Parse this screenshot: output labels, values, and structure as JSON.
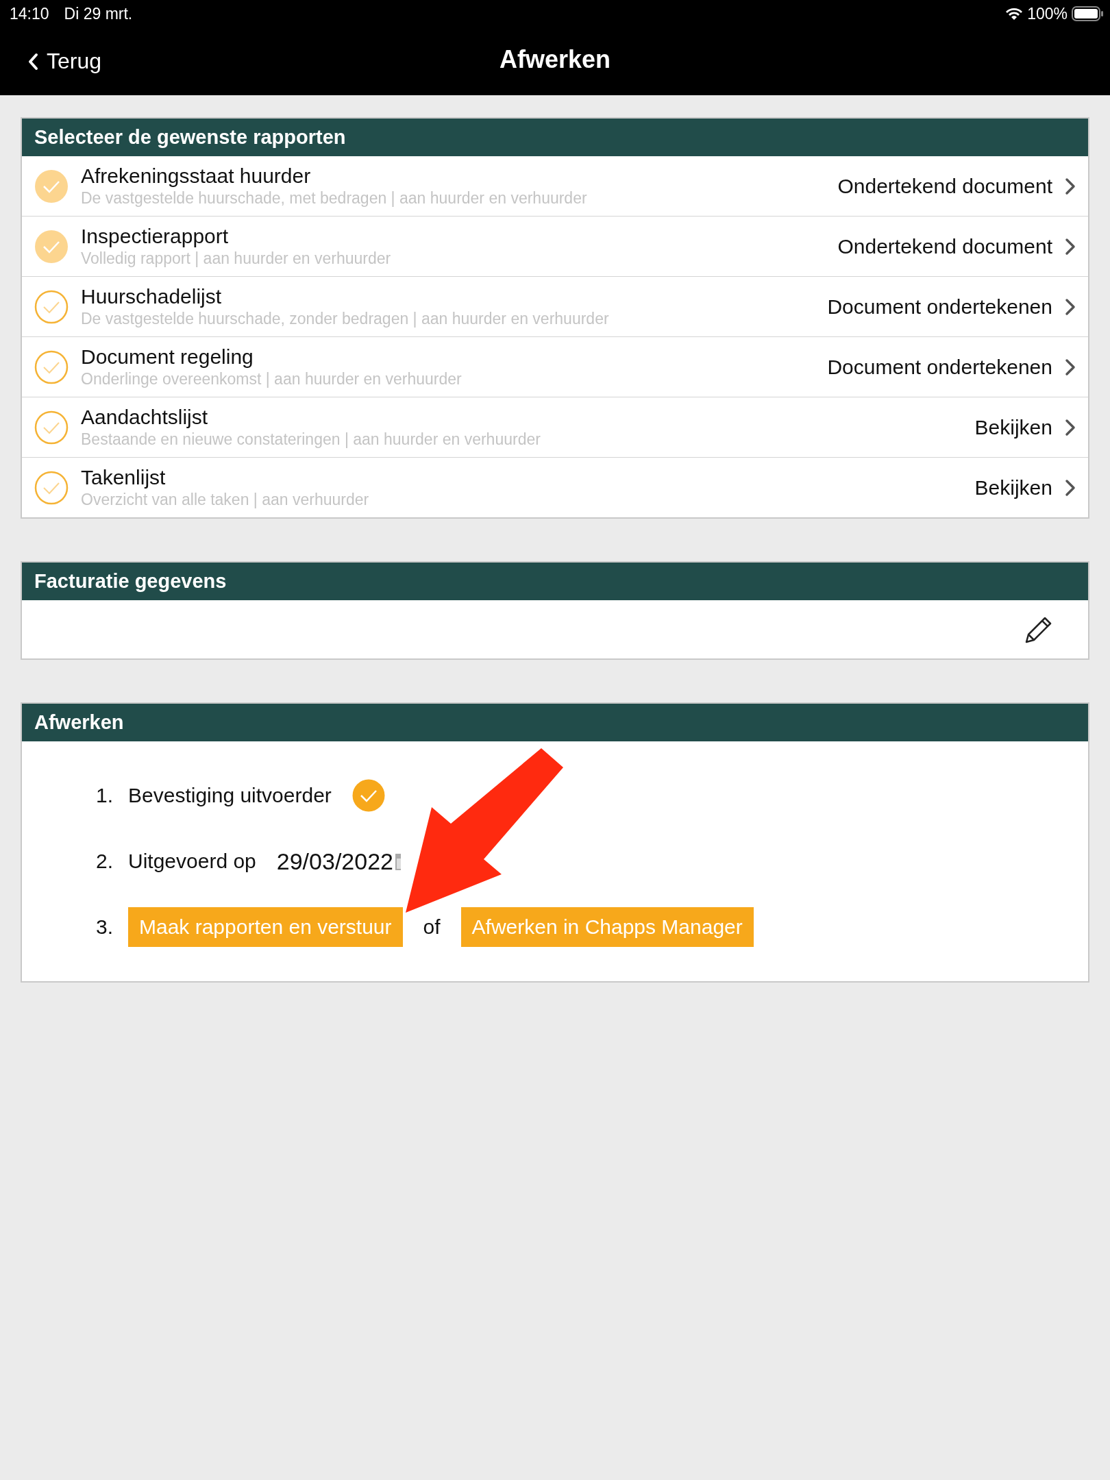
{
  "status_bar": {
    "time": "14:10",
    "date": "Di 29 mrt.",
    "battery": "100%"
  },
  "nav": {
    "back": "Terug",
    "title": "Afwerken"
  },
  "reports": {
    "title": "Selecteer de gewenste rapporten",
    "rows": [
      {
        "title": "Afrekeningsstaat huurder",
        "subtitle": "De vastgestelde huurschade, met bedragen | aan huurder en verhuurder",
        "action": "Ondertekend document",
        "checked": true
      },
      {
        "title": "Inspectierapport",
        "subtitle": "Volledig rapport | aan huurder en verhuurder",
        "action": "Ondertekend document",
        "checked": true
      },
      {
        "title": "Huurschadelijst",
        "subtitle": "De vastgestelde huurschade, zonder bedragen | aan huurder en verhuurder",
        "action": "Document ondertekenen",
        "checked": false
      },
      {
        "title": "Document regeling",
        "subtitle": "Onderlinge overeenkomst | aan huurder en verhuurder",
        "action": "Document ondertekenen",
        "checked": false
      },
      {
        "title": "Aandachtslijst",
        "subtitle": "Bestaande en nieuwe constateringen | aan huurder en verhuurder",
        "action": "Bekijken",
        "checked": false
      },
      {
        "title": "Takenlijst",
        "subtitle": "Overzicht van alle taken | aan verhuurder",
        "action": "Bekijken",
        "checked": false
      }
    ]
  },
  "billing": {
    "title": "Facturatie gegevens"
  },
  "finish": {
    "title": "Afwerken",
    "steps": [
      {
        "kind": "confirm",
        "number": "1.",
        "label": "Bevestiging uitvoerder",
        "checked": true
      },
      {
        "kind": "date",
        "number": "2.",
        "label": "Uitgevoerd op",
        "value": "29/03/2022"
      },
      {
        "kind": "actions",
        "number": "3.",
        "primary": "Maak rapporten en verstuur",
        "separator": "of",
        "secondary": "Afwerken in Chapps Manager"
      }
    ]
  }
}
